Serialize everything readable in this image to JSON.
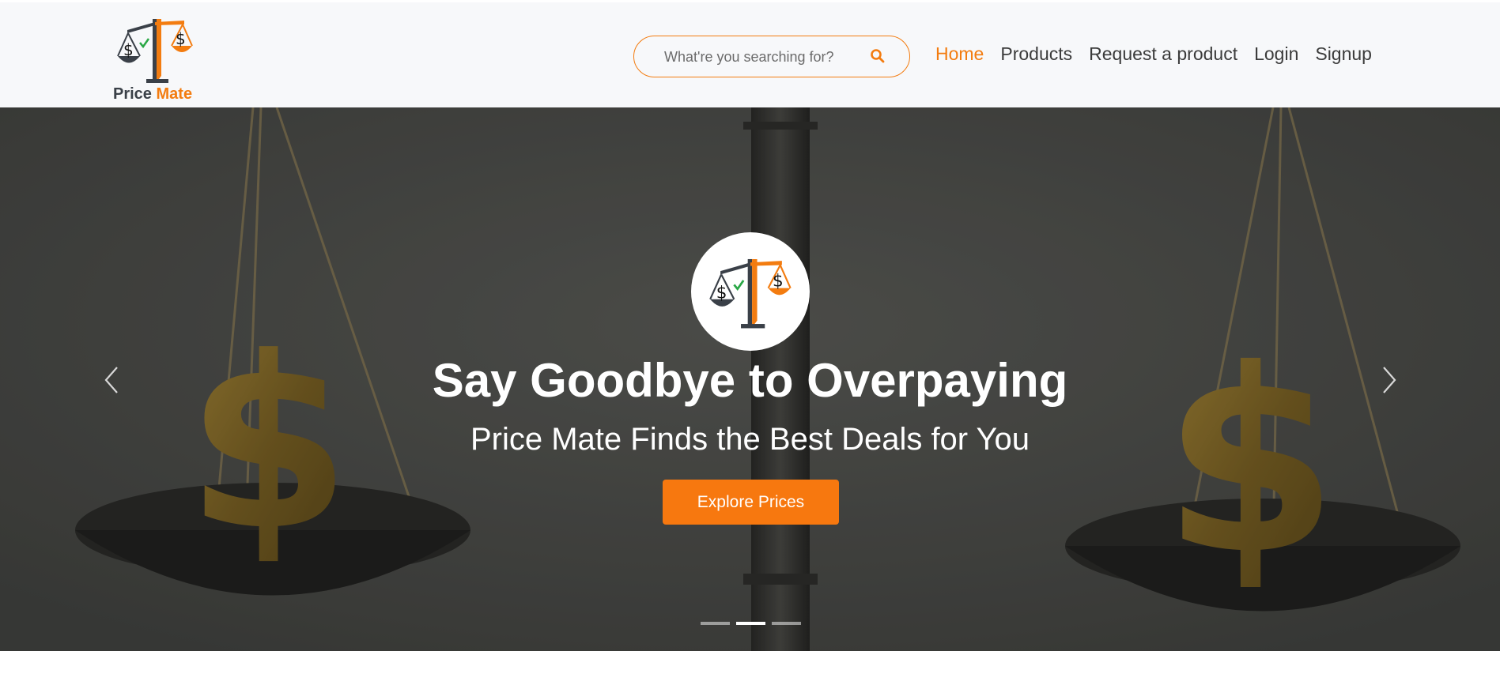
{
  "brand": {
    "name_part1": "Price",
    "name_part2": "Mate",
    "accent": "#f37c10",
    "dark": "#3a4048"
  },
  "search": {
    "placeholder": "What're you searching for?",
    "icon": "search-icon"
  },
  "nav": {
    "items": [
      {
        "label": "Home",
        "active": true
      },
      {
        "label": "Products"
      },
      {
        "label": "Request a product"
      },
      {
        "label": "Login"
      },
      {
        "label": "Signup"
      }
    ]
  },
  "hero": {
    "title": "Say Goodbye to Overpaying",
    "subtitle": "Price Mate Finds the Best Deals for You",
    "cta_label": "Explore Prices",
    "prev_icon": "chevron-left-icon",
    "next_icon": "chevron-right-icon",
    "slides_total": 3,
    "active_slide": 2
  }
}
